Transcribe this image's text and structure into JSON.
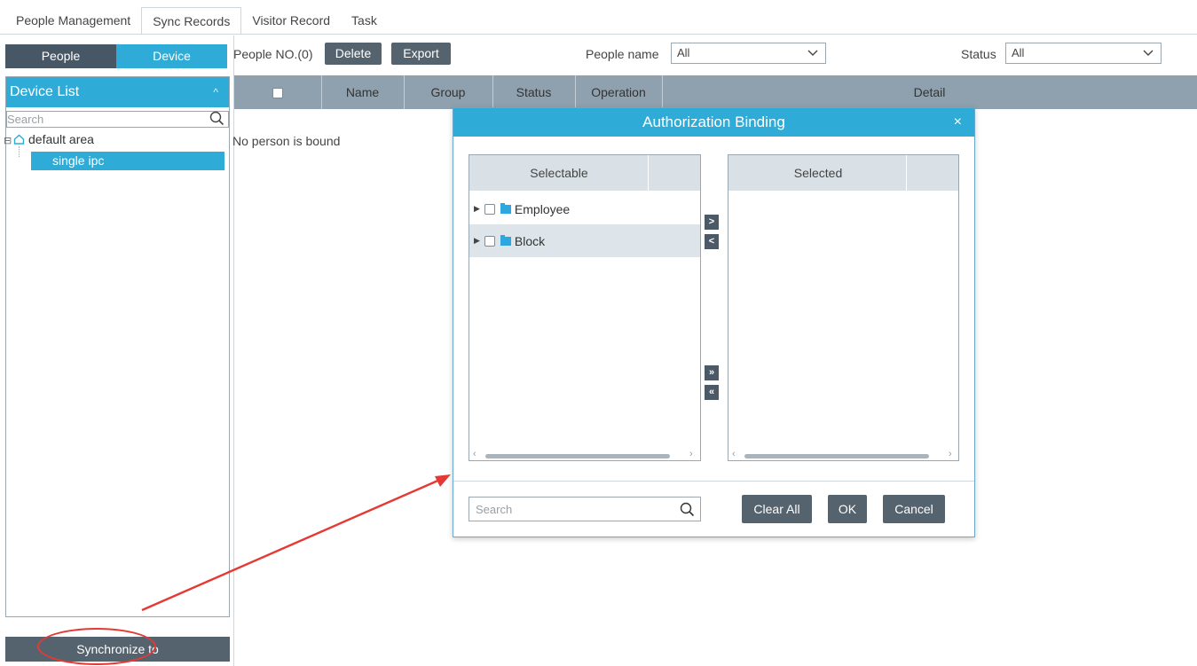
{
  "tabs": [
    "People Management",
    "Sync Records",
    "Visitor Record",
    "Task"
  ],
  "active_tab": "Sync Records",
  "left": {
    "seg_people": "People",
    "seg_device": "Device",
    "device_list_title": "Device List",
    "search_placeholder": "Search",
    "tree_root": "default area",
    "tree_selected": "single ipc",
    "sync_button": "Synchronize to"
  },
  "toolbar": {
    "people_no": "People NO.(0)",
    "delete": "Delete",
    "export": "Export",
    "people_name_label": "People name",
    "people_name_value": "All",
    "status_label": "Status",
    "status_value": "All"
  },
  "table": {
    "columns": [
      "Name",
      "Group",
      "Status",
      "Operation",
      "Detail"
    ],
    "empty_message": "No person is bound"
  },
  "modal": {
    "title": "Authorization Binding",
    "close": "×",
    "selectable_header": "Selectable",
    "selected_header": "Selected",
    "selectable_items": [
      "Employee",
      "Block"
    ],
    "btn_add": ">",
    "btn_remove": "<",
    "btn_add_all": "»",
    "btn_remove_all": "«",
    "search_placeholder": "Search",
    "clear_all": "Clear All",
    "ok": "OK",
    "cancel": "Cancel"
  },
  "colors": {
    "accent": "#2eabd6",
    "dark_button": "#55636f",
    "table_header": "#8fa1ae",
    "annotation_red": "#e53935"
  }
}
